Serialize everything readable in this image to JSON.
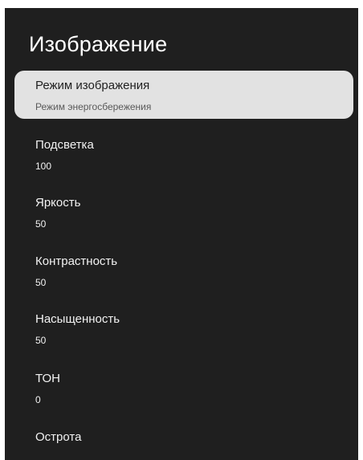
{
  "header": {
    "title": "Изображение"
  },
  "settings": [
    {
      "label": "Режим изображения",
      "value": "Режим энергосбережения",
      "selected": true
    },
    {
      "label": "Подсветка",
      "value": "100"
    },
    {
      "label": "Яркость",
      "value": "50"
    },
    {
      "label": "Контрастность",
      "value": "50"
    },
    {
      "label": "Насыщенность",
      "value": "50"
    },
    {
      "label": "ТОН",
      "value": "0"
    },
    {
      "label": "Острота",
      "value": ""
    }
  ],
  "colors": {
    "panel_background": "#1f1f1f",
    "selected_background": "#e2e2e2",
    "text": "#ffffff"
  }
}
